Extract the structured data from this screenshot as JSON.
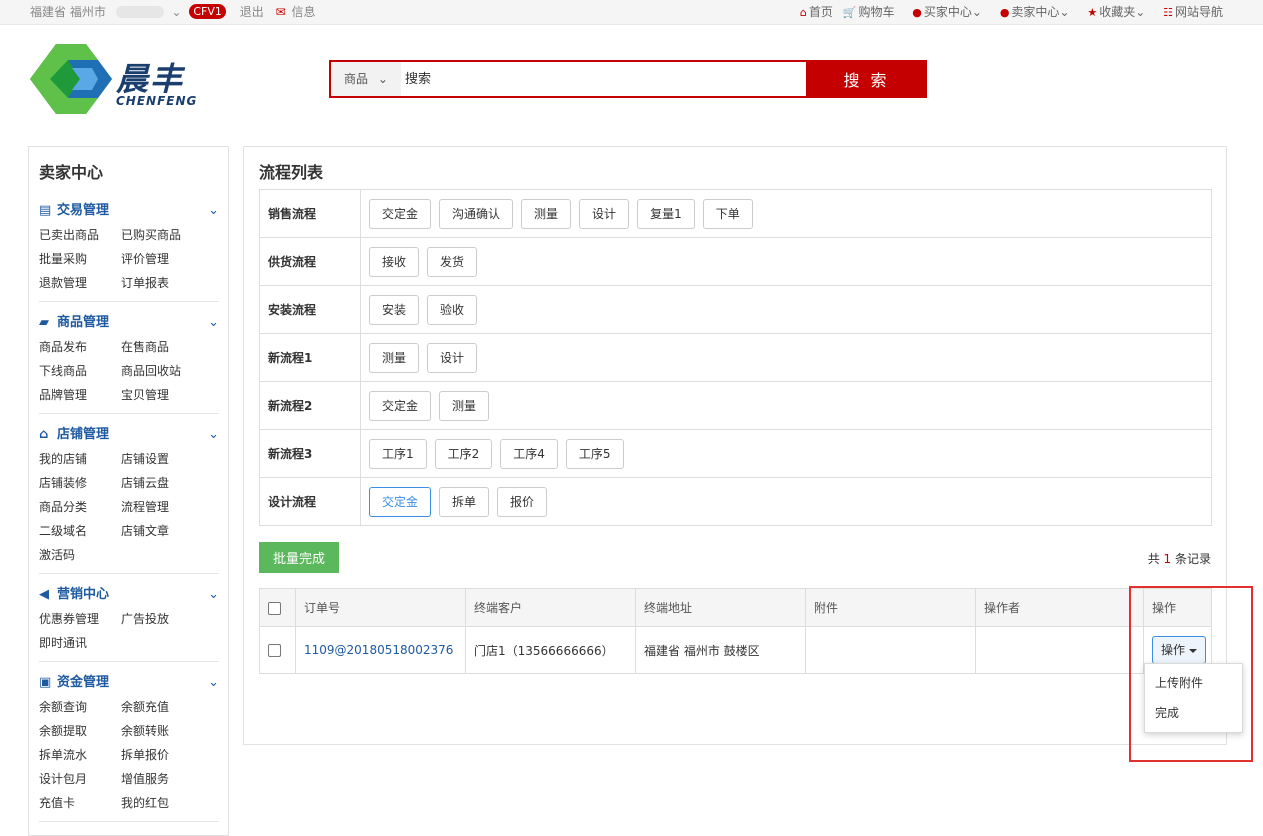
{
  "topbar": {
    "location": "福建省 福州市",
    "badge": "CFV1",
    "logout": "退出",
    "message": "信息",
    "home": "首页",
    "cart": "购物车",
    "buyer_center": "买家中心",
    "seller_center": "卖家中心",
    "favorites": "收藏夹",
    "site_nav": "网站导航"
  },
  "logo": {
    "cn": "晨丰",
    "en": "CHENFENG"
  },
  "search": {
    "category": "商品",
    "placeholder": "搜索",
    "button": "搜 索"
  },
  "sidebar": {
    "title": "卖家中心",
    "sections": [
      {
        "title": "交易管理",
        "items": [
          "已卖出商品",
          "已购买商品",
          "批量采购",
          "评价管理",
          "退款管理",
          "订单报表"
        ]
      },
      {
        "title": "商品管理",
        "items": [
          "商品发布",
          "在售商品",
          "下线商品",
          "商品回收站",
          "品牌管理",
          "宝贝管理"
        ]
      },
      {
        "title": "店铺管理",
        "items": [
          "我的店铺",
          "店铺设置",
          "店铺装修",
          "店铺云盘",
          "商品分类",
          "流程管理",
          "二级域名",
          "店铺文章",
          "激活码"
        ]
      },
      {
        "title": "营销中心",
        "items": [
          "优惠券管理",
          "广告投放",
          "即时通讯"
        ]
      },
      {
        "title": "资金管理",
        "items": [
          "余额查询",
          "余额充值",
          "余额提取",
          "余额转账",
          "拆单流水",
          "拆单报价",
          "设计包月",
          "增值服务",
          "充值卡",
          "我的红包"
        ]
      }
    ]
  },
  "main": {
    "title": "流程列表",
    "flows": [
      {
        "name": "销售流程",
        "steps": [
          "交定金",
          "沟通确认",
          "测量",
          "设计",
          "复量1",
          "下单"
        ]
      },
      {
        "name": "供货流程",
        "steps": [
          "接收",
          "发货"
        ]
      },
      {
        "name": "安装流程",
        "steps": [
          "安装",
          "验收"
        ]
      },
      {
        "name": "新流程1",
        "steps": [
          "测量",
          "设计"
        ]
      },
      {
        "name": "新流程2",
        "steps": [
          "交定金",
          "测量"
        ]
      },
      {
        "name": "新流程3",
        "steps": [
          "工序1",
          "工序2",
          "工序4",
          "工序5"
        ]
      },
      {
        "name": "设计流程",
        "steps": [
          "交定金",
          "拆单",
          "报价"
        ]
      }
    ],
    "batch_button": "批量完成",
    "records": {
      "prefix": "共 ",
      "count": "1",
      "suffix": " 条记录"
    },
    "columns": [
      "订单号",
      "终端客户",
      "终端地址",
      "附件",
      "操作者",
      "操作"
    ],
    "rows": [
      {
        "order_no": "1109@20180518002376",
        "customer": "门店1（13566666666）",
        "address": "福建省 福州市 鼓楼区",
        "attachment": "",
        "operator": "",
        "action": "操作"
      }
    ],
    "dropdown": [
      "上传附件",
      "完成"
    ]
  },
  "colors": {
    "brand_red": "#c40000",
    "link_blue": "#1e5aa0",
    "success_green": "#5cb85c",
    "highlight": "#e03030"
  }
}
